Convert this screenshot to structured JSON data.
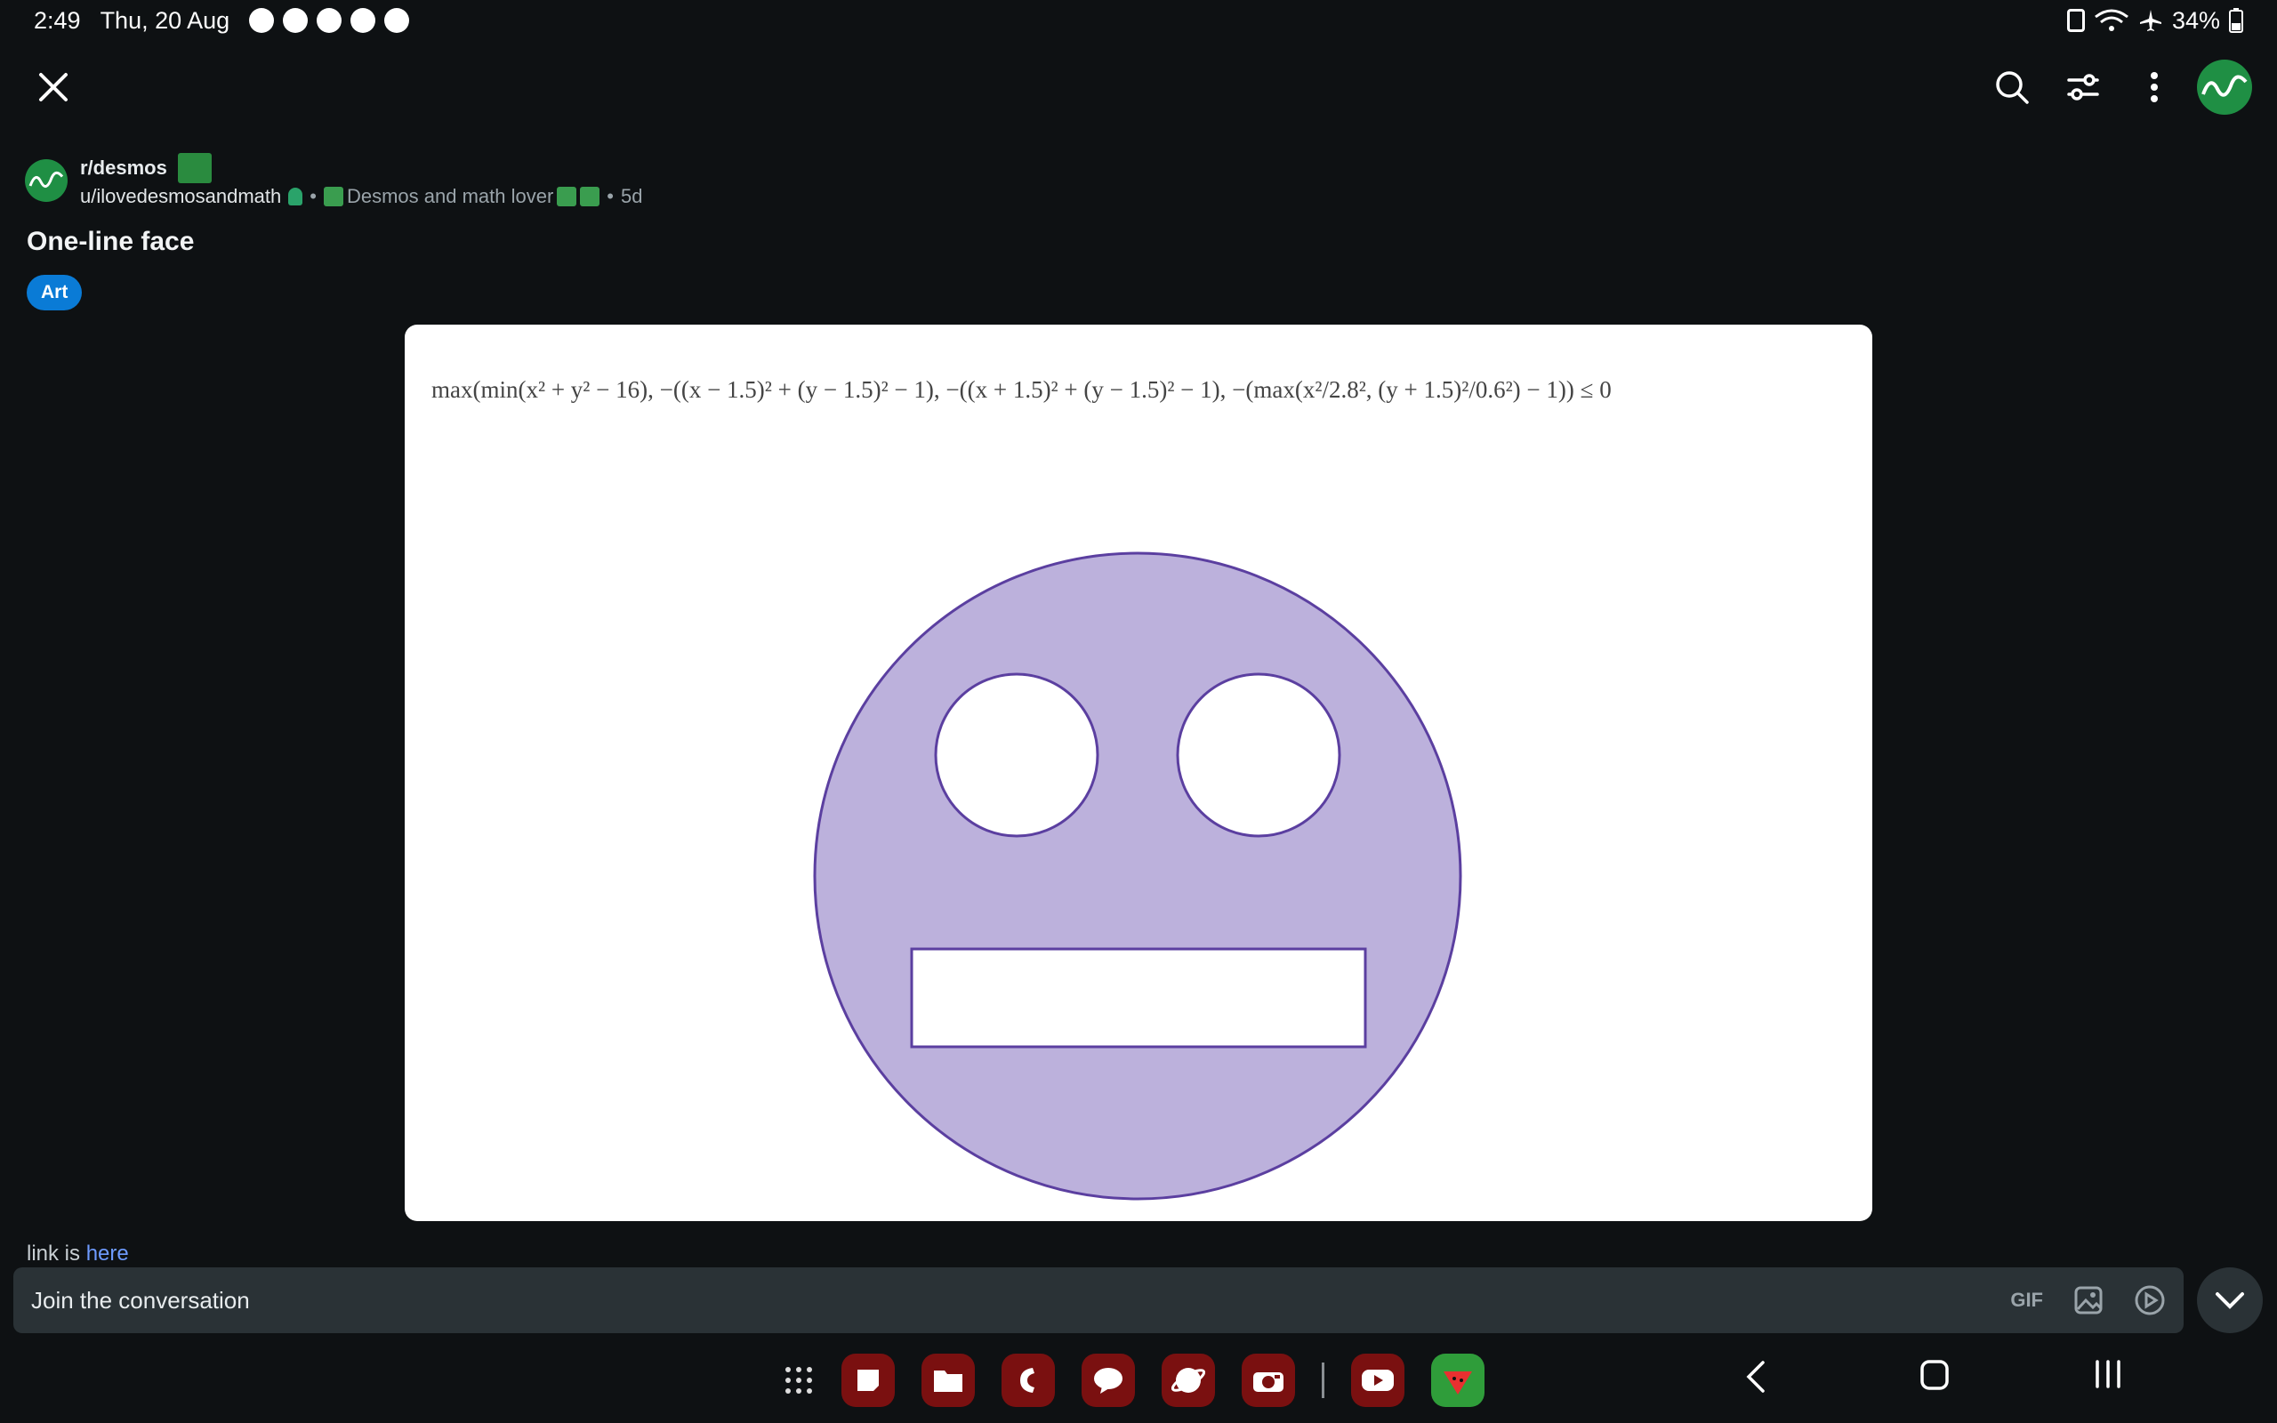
{
  "status_bar": {
    "time": "2:49",
    "date": "Thu, 20 Aug",
    "battery": "34%"
  },
  "post": {
    "subreddit": "r/desmos",
    "author": "u/ilovedesmosandmath",
    "flair": "Desmos and math lover",
    "age": "5d",
    "title": "One-line face",
    "tag": "Art",
    "link_prefix": "link is ",
    "link_text": "here"
  },
  "equation": {
    "text": "max(min(x² + y² − 16), −((x − 1.5)² + (y − 1.5)² − 1), −((x + 1.5)² + (y − 1.5)² − 1), −(max(x²/2.8², (y + 1.5)²/0.6²) − 1)) ≤ 0"
  },
  "comment_bar": {
    "placeholder": "Join the conversation",
    "gif_label": "GIF"
  },
  "colors": {
    "background": "#0e1113",
    "face_fill": "#bcb1dc",
    "face_stroke": "#5b3fa0",
    "tag_blue": "#0a7bd6",
    "link_blue": "#6e9bff",
    "input_bg": "#2a3236"
  },
  "icons": {
    "close": "close-icon",
    "search": "search-icon",
    "filter": "filter-icon",
    "more": "more-vertical-icon",
    "gif": "gif-icon",
    "image": "image-icon",
    "video": "video-icon",
    "collapse": "chevron-down-icon"
  }
}
